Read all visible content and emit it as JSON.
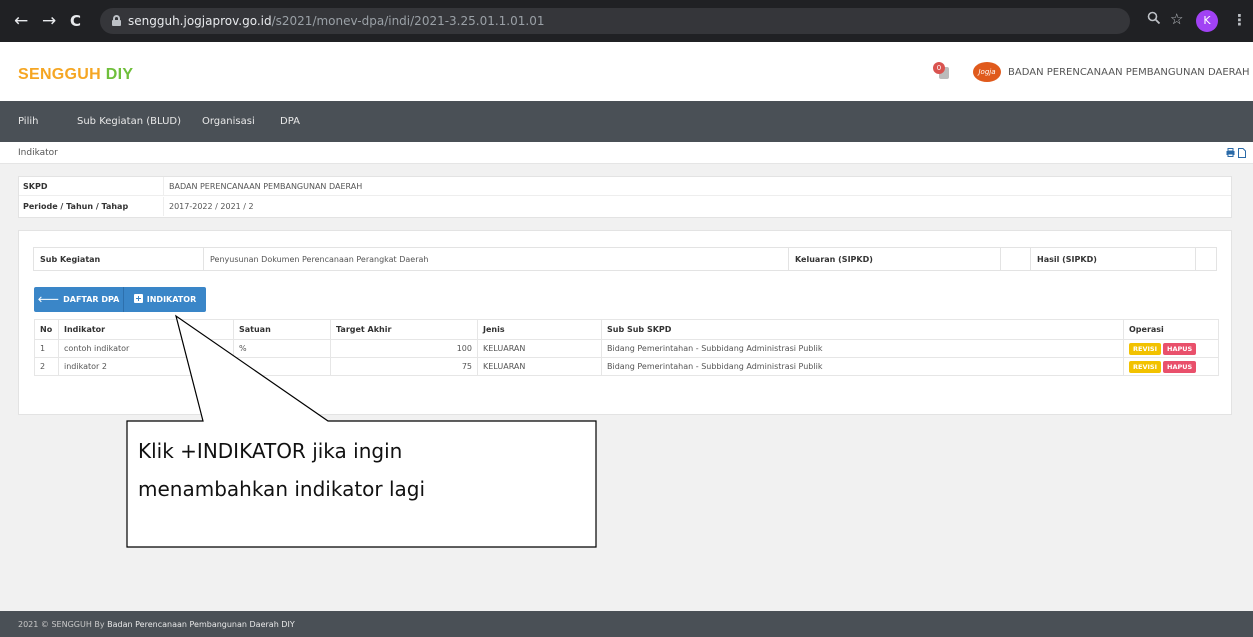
{
  "browser": {
    "back": "←",
    "forward": "→",
    "reload": "C",
    "url_domain": "sengguh.jogjaprov.go.id",
    "url_path": "/s2021/monev-dpa/indi/2021-3.25.01.1.01.01",
    "zoom_icon": "search-icon",
    "star_icon": "star-icon",
    "avatar_letter": "K",
    "menu": "⋮"
  },
  "header": {
    "brand_main": "SENGGUH",
    "brand_accent": " DIY",
    "notif_count": "0",
    "logo_text": "Jogja",
    "org_name": "BADAN PERENCANAAN PEMBANGUNAN DAERAH"
  },
  "menu": [
    "Pilih",
    "Sub Kegiatan (BLUD)",
    "Organisasi",
    "DPA"
  ],
  "breadcrumb": "Indikator",
  "info": {
    "skpd_label": "SKPD",
    "skpd_value": "BADAN PERENCANAAN PEMBANGUNAN DAERAH",
    "periode_label": "Periode / Tahun / Tahap",
    "periode_value": "2017-2022 / 2021 / 2"
  },
  "sub_kegiatan": {
    "label": "Sub Kegiatan",
    "value": "Penyusunan Dokumen Perencanaan Perangkat Daerah",
    "keluaran_label": "Keluaran (SIPKD)",
    "hasil_label": "Hasil (SIPKD)"
  },
  "buttons": {
    "daftar_dpa": "DAFTAR DPA",
    "indikator": "INDIKATOR"
  },
  "table": {
    "headers": [
      "No",
      "Indikator",
      "Satuan",
      "Target Akhir",
      "Jenis",
      "Sub Sub SKPD",
      "Operasi"
    ],
    "rows": [
      {
        "no": "1",
        "indikator": "contoh indikator",
        "satuan": "%",
        "target": "100",
        "jenis": "KELUARAN",
        "sub": "Bidang Pemerintahan - Subbidang Administrasi Publik"
      },
      {
        "no": "2",
        "indikator": "indikator 2",
        "satuan": "",
        "target": "75",
        "jenis": "KELUARAN",
        "sub": "Bidang Pemerintahan - Subbidang Administrasi Publik"
      }
    ],
    "revisi_label": "REVISI",
    "hapus_label": "HAPUS"
  },
  "callout": {
    "line1": "Klik +INDIKATOR jika ingin",
    "line2": "menambahkan indikator lagi"
  },
  "footer": {
    "prefix": "2021 © SENGGUH By ",
    "org": "Badan Perencanaan Pembangunan Daerah DIY"
  }
}
